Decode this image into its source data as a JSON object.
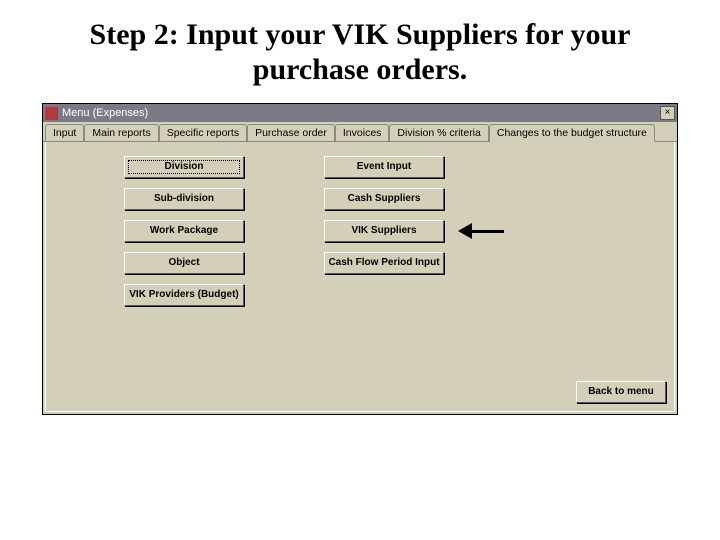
{
  "slide": {
    "title": "Step 2: Input your VIK Suppliers for your purchase orders."
  },
  "window": {
    "title": "Menu (Expenses)"
  },
  "tabs": [
    {
      "label": "Input"
    },
    {
      "label": "Main reports"
    },
    {
      "label": "Specific reports"
    },
    {
      "label": "Purchase order"
    },
    {
      "label": "Invoices"
    },
    {
      "label": "Division % criteria"
    },
    {
      "label": "Changes to the budget structure"
    }
  ],
  "buttons": {
    "col1": {
      "division": "Division",
      "subdivision": "Sub-division",
      "workpackage": "Work Package",
      "object": "Object",
      "vikproviders": "VIK Providers (Budget)"
    },
    "col2": {
      "eventinput": "Event Input",
      "cashsuppliers": "Cash Suppliers",
      "viksuppliers": "VIK Suppliers",
      "cashflow": "Cash Flow Period Input"
    },
    "back": "Back to menu"
  }
}
